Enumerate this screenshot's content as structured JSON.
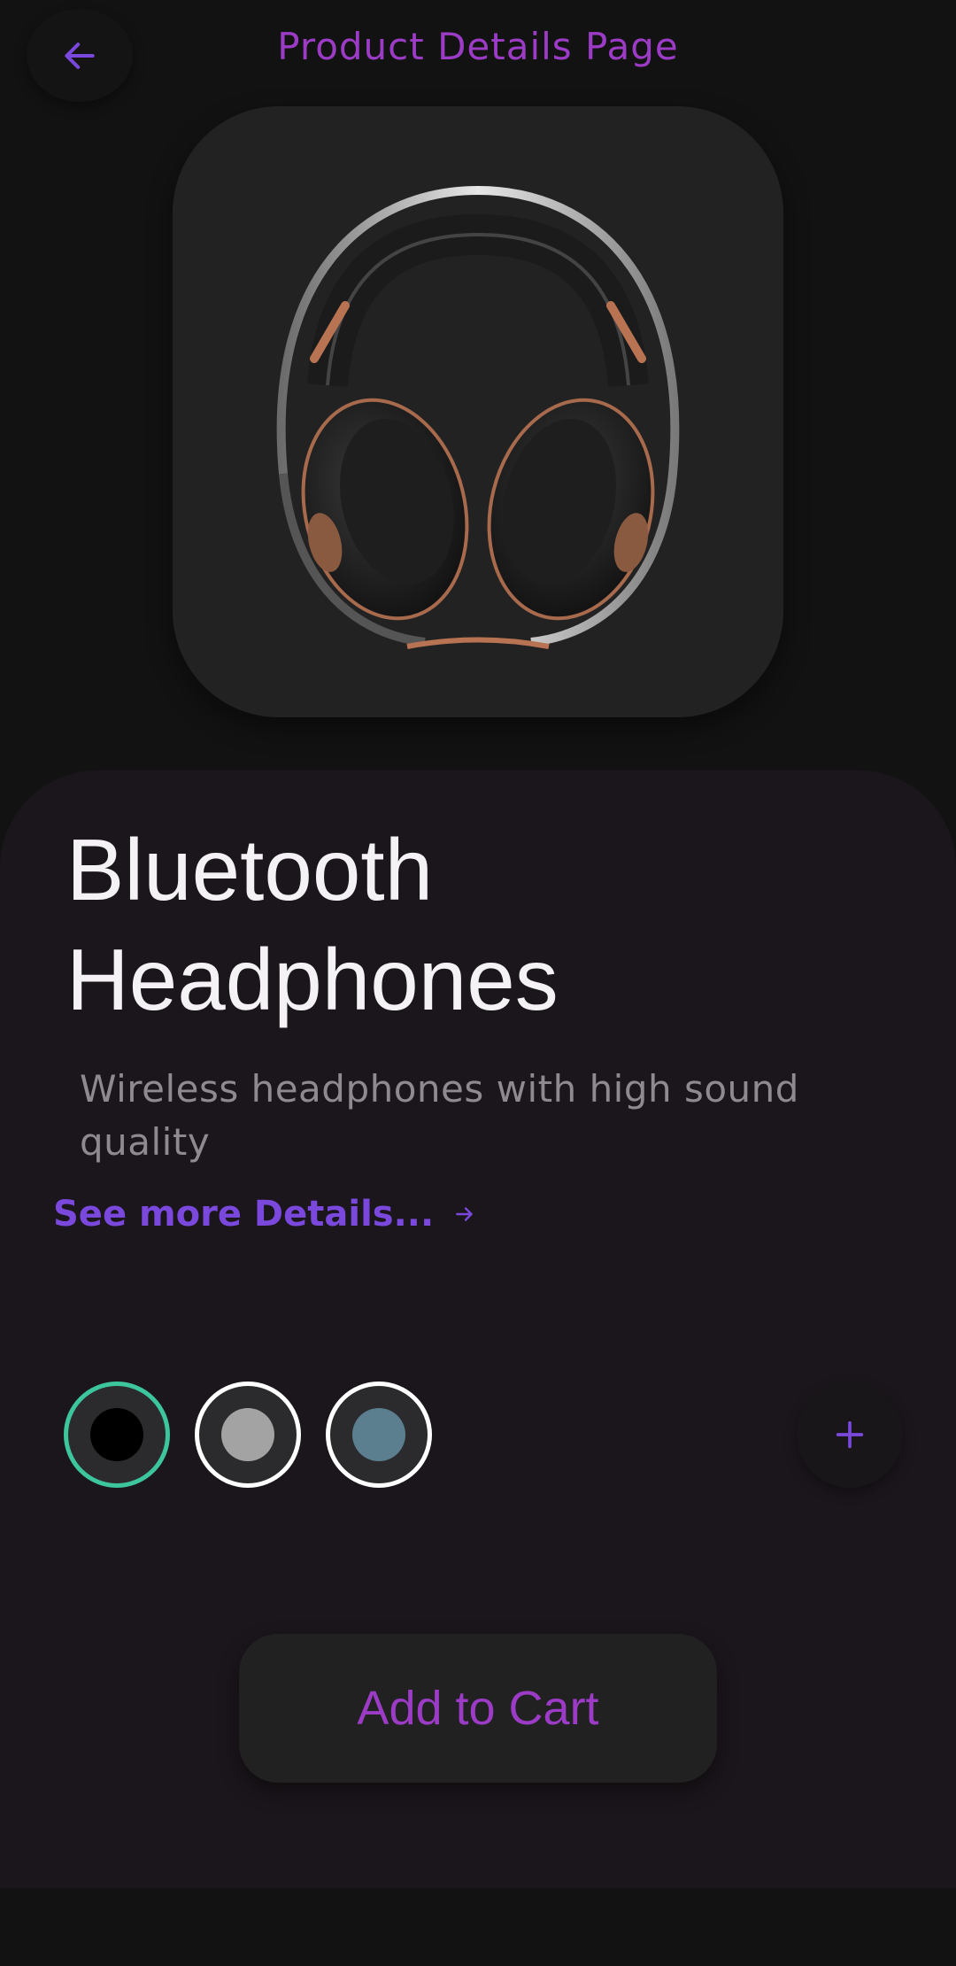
{
  "header": {
    "title": "Product Details Page",
    "back_icon": "arrow-left-icon"
  },
  "product": {
    "image_icon": "headphones-image",
    "name_line1": "Bluetooth",
    "name_line2": "Headphones",
    "description": "Wireless headphones with high sound quality",
    "details_link": "See more Details..."
  },
  "colors": {
    "accent": "#9c3cc6",
    "link": "#7a48dc",
    "selected_ring": "#3dc59d",
    "options": [
      {
        "name": "black",
        "hex": "#000000",
        "selected": true
      },
      {
        "name": "gray",
        "hex": "#a3a3a3",
        "selected": false
      },
      {
        "name": "slate-blue",
        "hex": "#5c7f90",
        "selected": false
      }
    ]
  },
  "actions": {
    "add_icon": "plus-icon",
    "add_to_cart": "Add to Cart"
  }
}
